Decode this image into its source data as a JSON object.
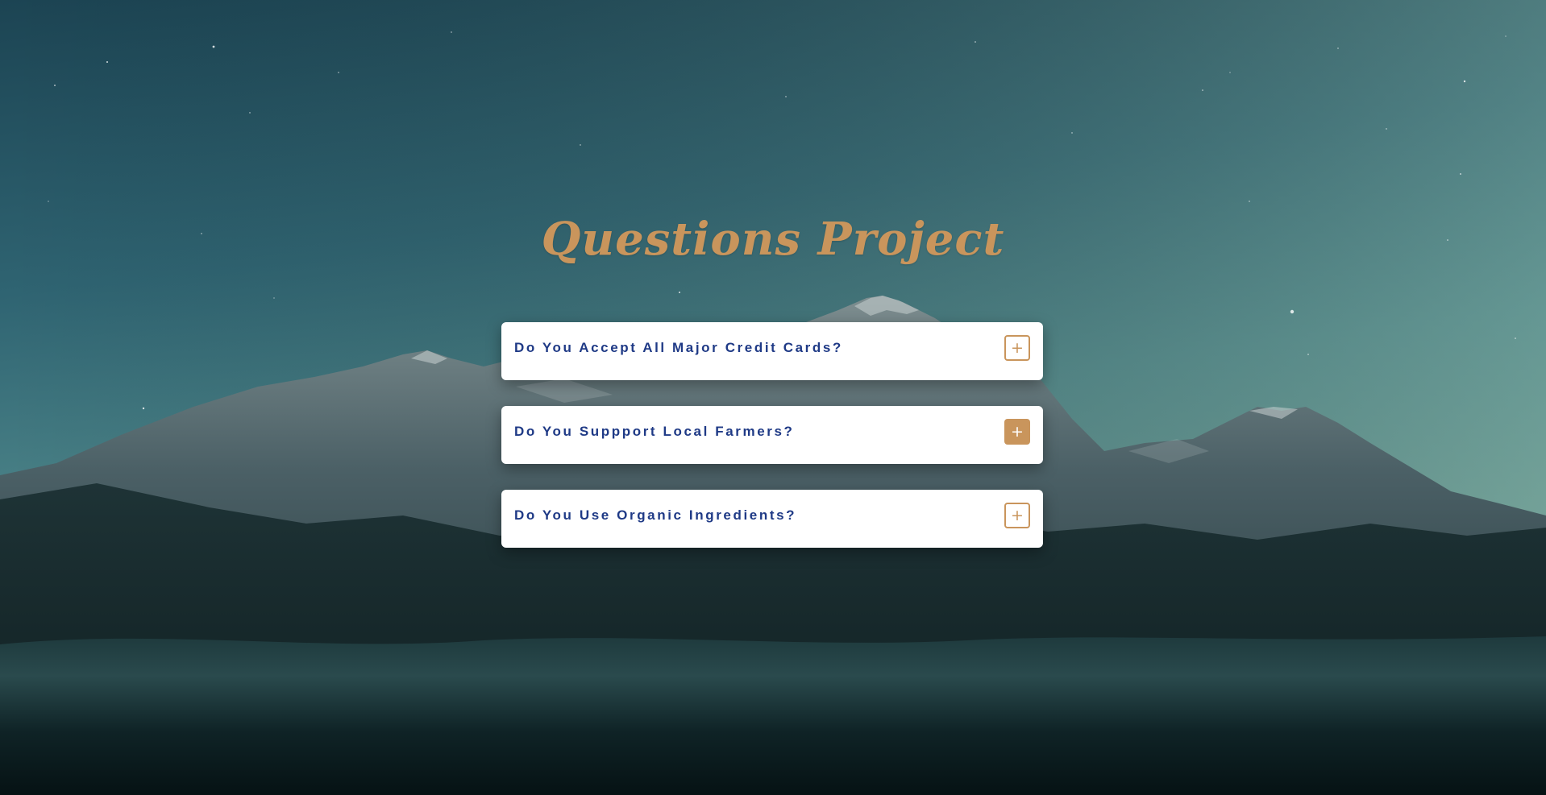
{
  "page": {
    "title": "Questions Project"
  },
  "questions": [
    {
      "title": "Do You Accept All Major Credit Cards?",
      "toggle_label": "+"
    },
    {
      "title": "Do You Suppport Local Farmers?",
      "toggle_label": "+"
    },
    {
      "title": "Do You Use Organic Ingredients?",
      "toggle_label": "+"
    }
  ],
  "colors": {
    "accent": "#c9955c",
    "question_text": "#1f3a86",
    "card_bg": "#ffffff"
  },
  "icons": {
    "toggle": "plus-icon"
  }
}
